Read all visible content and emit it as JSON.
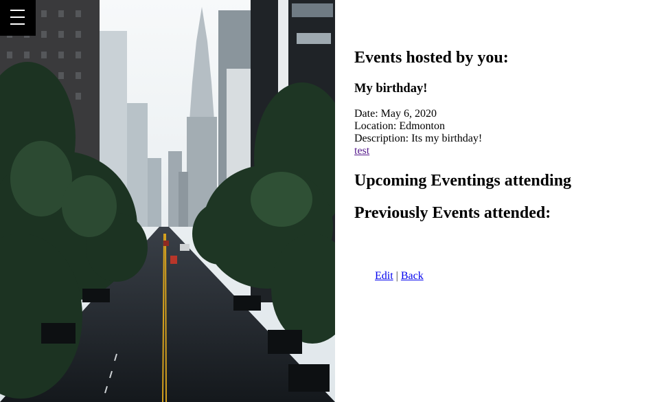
{
  "menu": {
    "icon": "hamburger-menu-icon"
  },
  "hero": {
    "description_icon": "city-street-photo"
  },
  "hosted": {
    "heading": "Events hosted by you:",
    "events": [
      {
        "title": "My birthday!",
        "date_label": "Date:",
        "date": "May 6, 2020",
        "location_label": "Location:",
        "location": "Edmonton",
        "description_label": "Description:",
        "description": "Its my birthday!",
        "link": "test"
      }
    ]
  },
  "upcoming": {
    "heading": "Upcoming Eventings attending"
  },
  "previous": {
    "heading": "Previously Events attended:"
  },
  "footer": {
    "edit_label": "Edit",
    "separator": "|",
    "back_label": "Back"
  },
  "colors": {
    "link": "#0000ee",
    "visited_link": "#551a8b",
    "menu_bg": "#000000"
  }
}
